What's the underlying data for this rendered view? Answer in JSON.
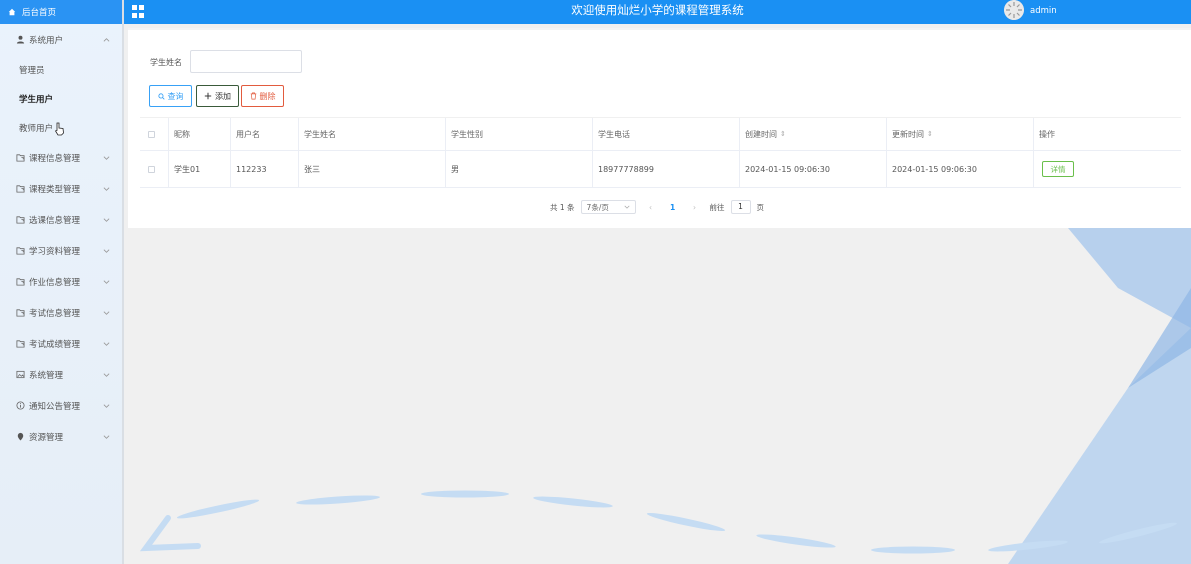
{
  "sidebar": {
    "home_label": "后台首页",
    "system_users": {
      "label": "系统用户",
      "items": [
        "管理员",
        "学生用户",
        "教师用户"
      ],
      "active_item": "学生用户"
    },
    "groups": [
      {
        "label": "课程信息管理",
        "icon": "folder-share-icon"
      },
      {
        "label": "课程类型管理",
        "icon": "folder-share-icon"
      },
      {
        "label": "选课信息管理",
        "icon": "folder-share-icon"
      },
      {
        "label": "学习资料管理",
        "icon": "folder-share-icon"
      },
      {
        "label": "作业信息管理",
        "icon": "folder-share-icon"
      },
      {
        "label": "考试信息管理",
        "icon": "folder-share-icon"
      },
      {
        "label": "考试成绩管理",
        "icon": "folder-share-icon"
      },
      {
        "label": "系统管理",
        "icon": "picture-icon"
      },
      {
        "label": "通知公告管理",
        "icon": "info-circle-icon"
      },
      {
        "label": "资源管理",
        "icon": "location-pin-icon"
      }
    ]
  },
  "header": {
    "title": "欢迎使用灿烂小学的课程管理系统",
    "username": "admin",
    "accent_color": "#1a90f3"
  },
  "search": {
    "label": "学生姓名",
    "value": "",
    "placeholder": ""
  },
  "toolbar": {
    "query_label": "查询",
    "add_label": "添加",
    "delete_label": "删除"
  },
  "table": {
    "headers": [
      "昵称",
      "用户名",
      "学生姓名",
      "学生性别",
      "学生电话",
      "创建时间",
      "更新时间",
      "操作"
    ],
    "rows": [
      {
        "nickname": "学生01",
        "username": "112233",
        "name": "张三",
        "gender": "男",
        "phone": "18977778899",
        "created": "2024-01-15 09:06:30",
        "updated": "2024-01-15 09:06:30",
        "action_label": "详情"
      }
    ]
  },
  "pagination": {
    "total_text": "共 1 条",
    "page_size": "7条/页",
    "current_page": "1",
    "goto_prefix": "前往",
    "goto_value": "1",
    "goto_suffix": "页"
  }
}
